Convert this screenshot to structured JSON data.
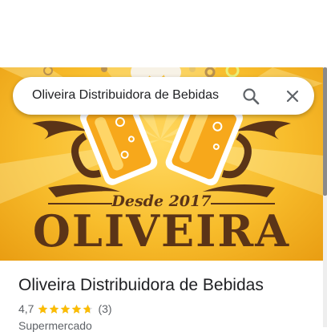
{
  "search": {
    "query": "Oliveira Distribuidora de Bebidas",
    "search_icon": "search-icon",
    "close_icon": "close-icon"
  },
  "hero": {
    "logo_text": "OLIVEIRA",
    "logo_tagline": "Desde 2017"
  },
  "place": {
    "name": "Oliveira Distribuidora de Bebidas",
    "rating": "4,7",
    "rating_stars": 4.7,
    "review_count": "(3)",
    "category": "Supermercado"
  },
  "colors": {
    "star": "#fbbc04",
    "logo_brown": "#5b3417",
    "background_yellow": "#f8bd2c"
  }
}
